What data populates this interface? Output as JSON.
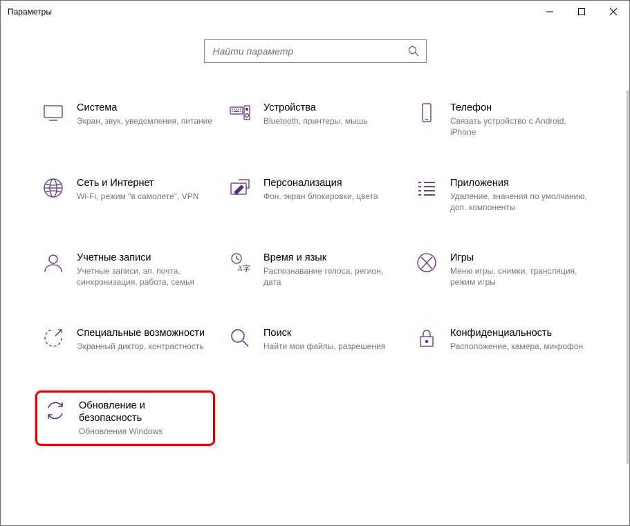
{
  "window": {
    "title": "Параметры"
  },
  "search": {
    "placeholder": "Найти параметр"
  },
  "categories": [
    {
      "id": "system",
      "title": "Система",
      "desc": "Экран, звук, уведомления, питание"
    },
    {
      "id": "devices",
      "title": "Устройства",
      "desc": "Bluetooth, принтеры, мышь"
    },
    {
      "id": "phone",
      "title": "Телефон",
      "desc": "Связать устройство с Android, iPhone"
    },
    {
      "id": "network",
      "title": "Сеть и Интернет",
      "desc": "Wi-Fi, режим \"в самолете\", VPN"
    },
    {
      "id": "personalization",
      "title": "Персонализация",
      "desc": "Фон, экран блокировки, цвета"
    },
    {
      "id": "apps",
      "title": "Приложения",
      "desc": "Удаление, значения по умолчанию, доп. компоненты"
    },
    {
      "id": "accounts",
      "title": "Учетные записи",
      "desc": "Учетные записи, эл. почта, синхронизация, работа, семья"
    },
    {
      "id": "time",
      "title": "Время и язык",
      "desc": "Распознавание голоса, регион, дата"
    },
    {
      "id": "gaming",
      "title": "Игры",
      "desc": "Меню игры, снимки, трансляция, режим игры"
    },
    {
      "id": "ease",
      "title": "Специальные возможности",
      "desc": "Экранный диктор, контрастность"
    },
    {
      "id": "search",
      "title": "Поиск",
      "desc": "Найти мои файлы, разрешения"
    },
    {
      "id": "privacy",
      "title": "Конфиденциальность",
      "desc": "Расположение, камера, микрофон"
    },
    {
      "id": "update",
      "title": "Обновление и безопасность",
      "desc": "Обновления Windows"
    }
  ],
  "colors": {
    "accent": "#5a2d79",
    "highlight": "#e40000"
  }
}
